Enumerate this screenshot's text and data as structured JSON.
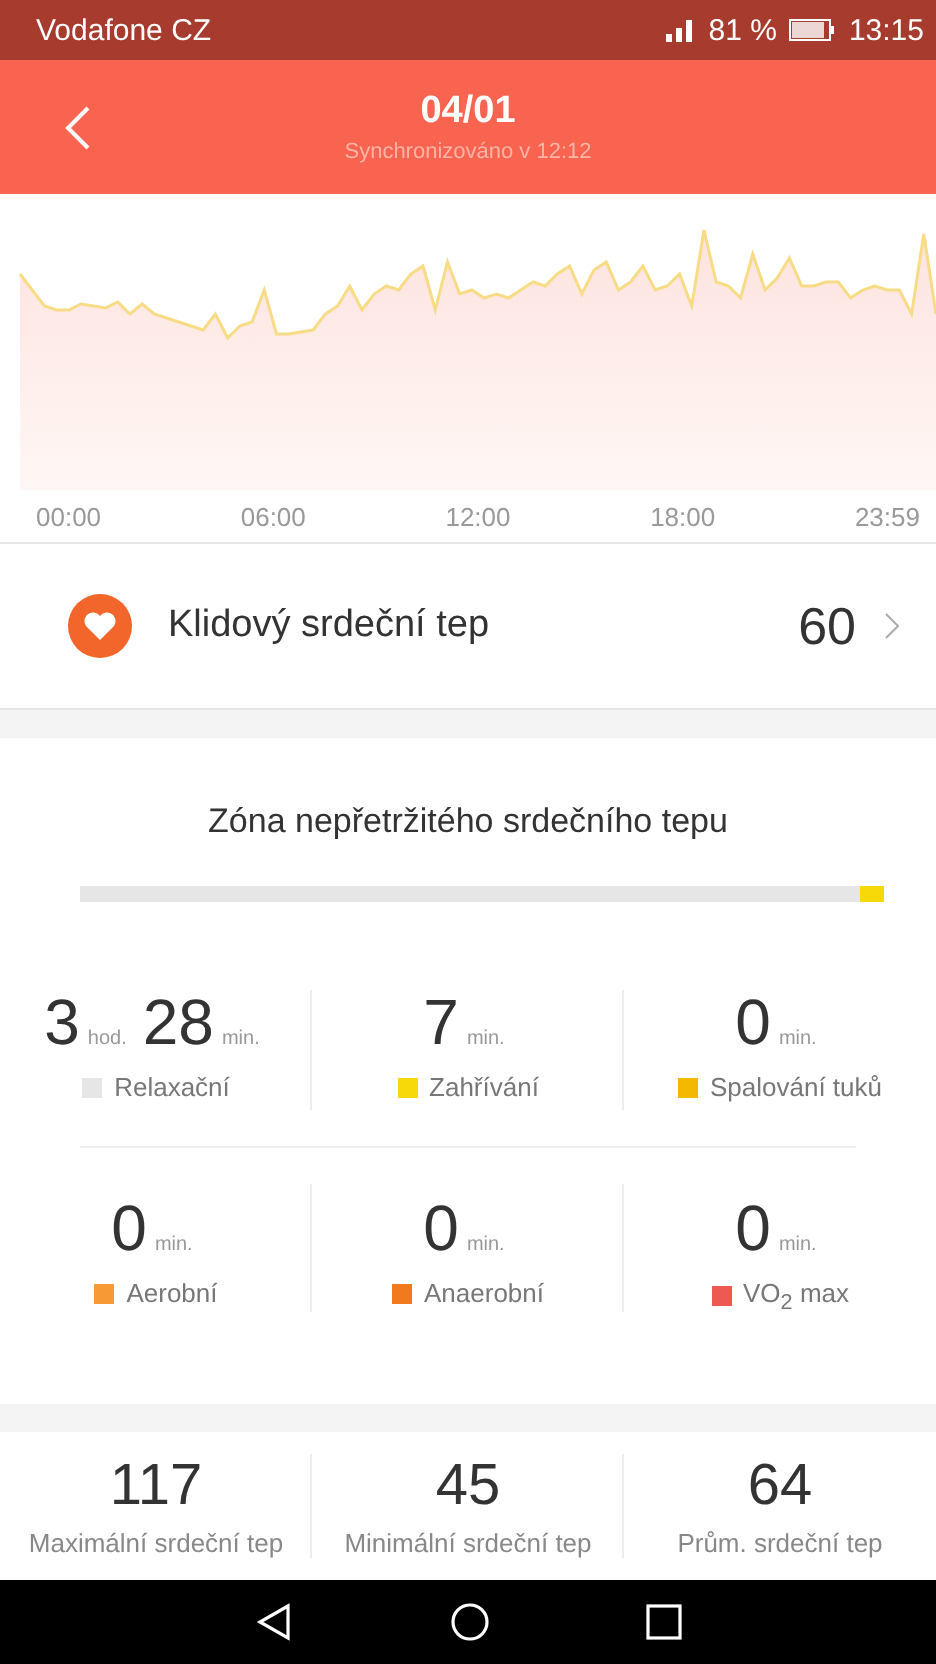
{
  "status_bar": {
    "carrier": "Vodafone CZ",
    "battery": "81 %",
    "time": "13:15"
  },
  "header": {
    "title": "04/01",
    "subtitle": "Synchronizováno v 12:12"
  },
  "chart": {
    "x_labels": [
      "00:00",
      "06:00",
      "12:00",
      "18:00",
      "23:59"
    ]
  },
  "resting": {
    "label": "Klidový srdeční tep",
    "value": "60"
  },
  "zones_title": "Zóna nepřetržitého srdečního tepu",
  "zones": [
    {
      "hours": "3",
      "hours_unit": "hod.",
      "value": "28",
      "unit": "min.",
      "label": "Relaxační",
      "color": "#e6e6e6",
      "level": 0.97
    },
    {
      "value": "7",
      "unit": "min.",
      "label": "Zahřívání",
      "color": "#f7d90a",
      "level": 0.03
    },
    {
      "value": "0",
      "unit": "min.",
      "label": "Spalování tuků",
      "color": "#f5b800"
    },
    {
      "value": "0",
      "unit": "min.",
      "label": "Aerobní",
      "color": "#f79a35"
    },
    {
      "value": "0",
      "unit": "min.",
      "label": "Anaerobní",
      "color": "#f27a1e"
    },
    {
      "value": "0",
      "unit": "min.",
      "label": "VO$_{2}$ max",
      "color": "#ee5a52"
    }
  ],
  "stats": [
    {
      "value": "117",
      "label": "Maximální srdeční tep"
    },
    {
      "value": "45",
      "label": "Minimální srdeční tep"
    },
    {
      "value": "64",
      "label": "Prům. srdeční tep"
    }
  ]
}
